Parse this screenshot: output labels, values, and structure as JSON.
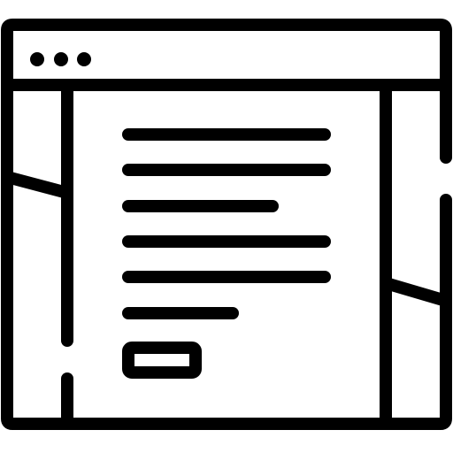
{
  "icon": {
    "name": "web-page-template-icon",
    "stroke_color": "#000000",
    "background_color": "#ffffff",
    "title_bar": {
      "window_controls": [
        "dot",
        "dot",
        "dot"
      ]
    },
    "content": {
      "text_lines": 6,
      "button_count": 1
    }
  }
}
